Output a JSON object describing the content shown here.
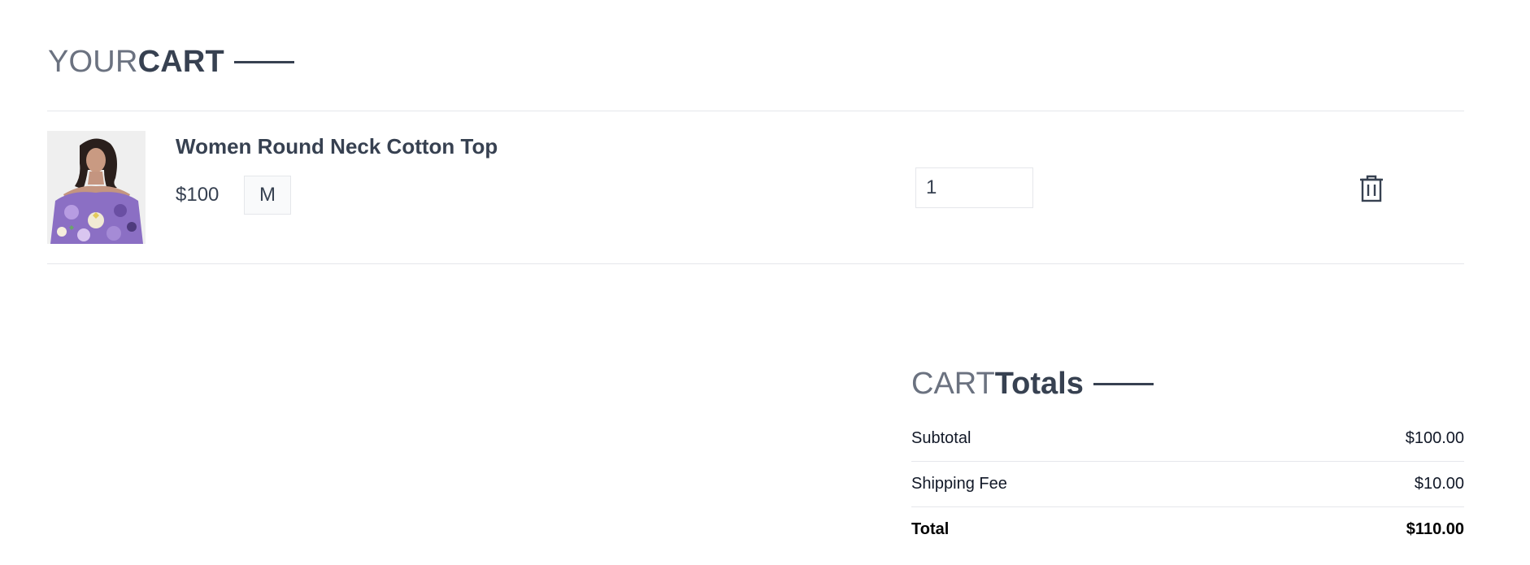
{
  "cart_header": {
    "title_light": "YOUR",
    "title_bold": "CART"
  },
  "cart_items": [
    {
      "name": "Women Round Neck Cotton Top",
      "price": "$100",
      "size": "M",
      "quantity": "1",
      "image_icon": "product-photo-floral-top",
      "delete_icon": "trash-icon"
    }
  ],
  "totals": {
    "title_light": "CART",
    "title_bold": "Totals",
    "subtotal_label": "Subtotal",
    "subtotal_value": "$100.00",
    "shipping_label": "Shipping Fee",
    "shipping_value": "$10.00",
    "total_label": "Total",
    "total_value": "$110.00"
  },
  "colors": {
    "heading_light": "#6b7280",
    "heading_dark": "#374151",
    "divider": "#e5e7eb"
  }
}
